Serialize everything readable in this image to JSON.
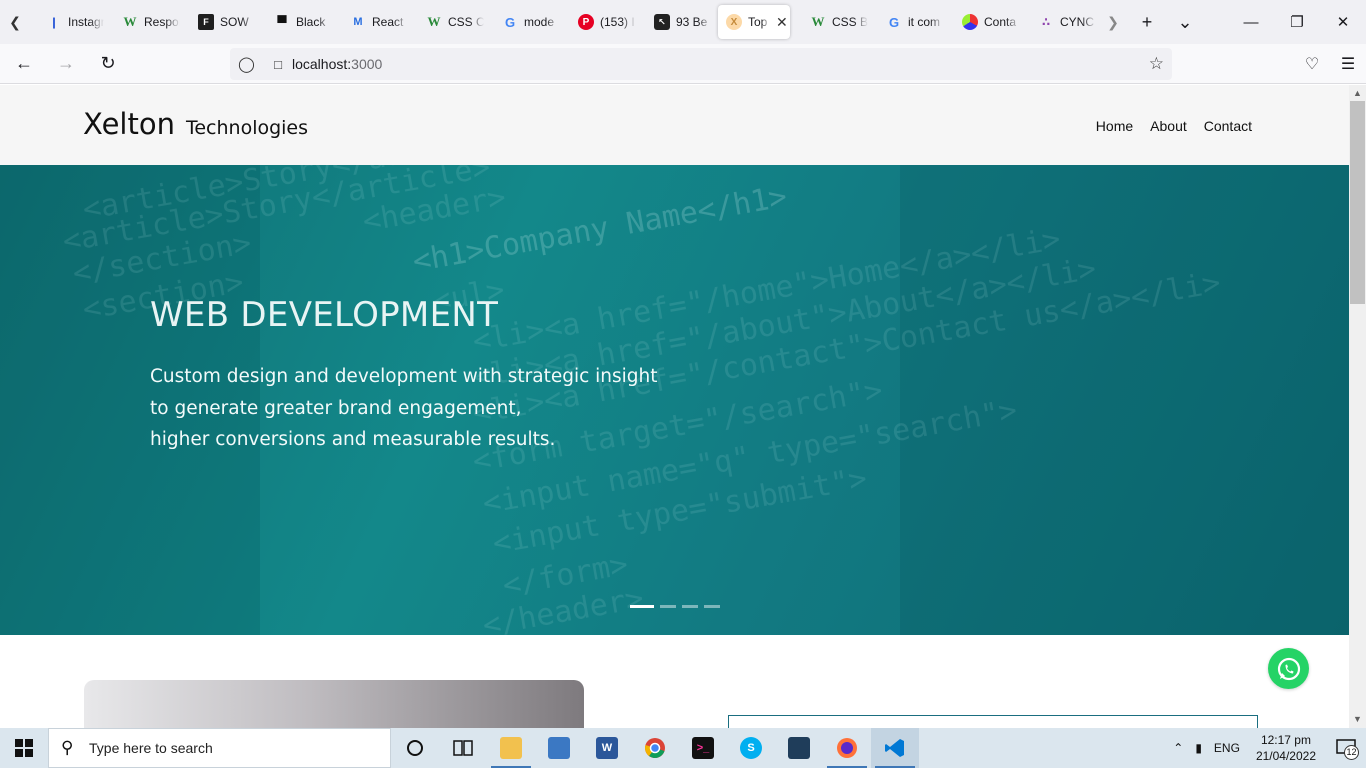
{
  "browser": {
    "tabs": [
      {
        "label": "Instagram",
        "icon": "instagram-icon",
        "favicon": "❙"
      },
      {
        "label": "Responsive",
        "icon": "w3schools-icon",
        "favicon": "W"
      },
      {
        "label": "SOW",
        "icon": "figma-icon",
        "favicon": "F"
      },
      {
        "label": "Black",
        "icon": "blackbox-icon",
        "favicon": "▀"
      },
      {
        "label": "React",
        "icon": "react-icon",
        "favicon": "M"
      },
      {
        "label": "CSS C",
        "icon": "w3schools-icon",
        "favicon": "W"
      },
      {
        "label": "mode",
        "icon": "google-icon",
        "favicon": "G"
      },
      {
        "label": "(153) I",
        "icon": "pinterest-icon",
        "favicon": "P"
      },
      {
        "label": "93 Be",
        "icon": "cursor-icon",
        "favicon": "↖"
      },
      {
        "label": "Top",
        "icon": "xelton-tab-icon",
        "favicon": "X",
        "active": true
      },
      {
        "label": "CSS B",
        "icon": "w3schools-icon",
        "favicon": "W"
      },
      {
        "label": "it com",
        "icon": "google-icon",
        "favicon": "G"
      },
      {
        "label": "Conta",
        "icon": "contact-tab-icon",
        "favicon": ""
      },
      {
        "label": "CYNC",
        "icon": "cync-icon",
        "favicon": "∴"
      }
    ],
    "url": {
      "host": "localhost:",
      "port": "3000"
    }
  },
  "site": {
    "brand_main": "Xelton",
    "brand_sub": "Technologies",
    "nav": [
      "Home",
      "About",
      "Contact"
    ]
  },
  "hero": {
    "title": "WEB DEVELOPMENT",
    "lines": [
      "Custom design and development with strategic insight",
      "to generate greater brand engagement,",
      "higher conversions and measurable results."
    ],
    "slides": 4,
    "active_slide": 0,
    "background_code": [
      "<article>Story</article>",
      "<article>Story</article>",
      "</section>",
      "<section>",
      "<header>",
      "<h1>Company Name</h1>",
      "<ul>",
      "<li><a href=\"/home\">Home</a></li>",
      "<li><a href=\"/about\">About</a></li>",
      "<li><a href=\"/contact\">Contact us</a></li>",
      "<form target=\"/search\">",
      "<input name=\"q\" type=\"search\">",
      "<input type=\"submit\">",
      "</form>",
      "</header>"
    ]
  },
  "taskbar": {
    "search_placeholder": "Type here to search",
    "language": "ENG",
    "time": "12:17 pm",
    "date": "21/04/2022",
    "notifications": "12"
  },
  "colors": {
    "hero_teal": "#13888a",
    "whatsapp": "#25d366",
    "taskbar": "#dbe6ee"
  }
}
